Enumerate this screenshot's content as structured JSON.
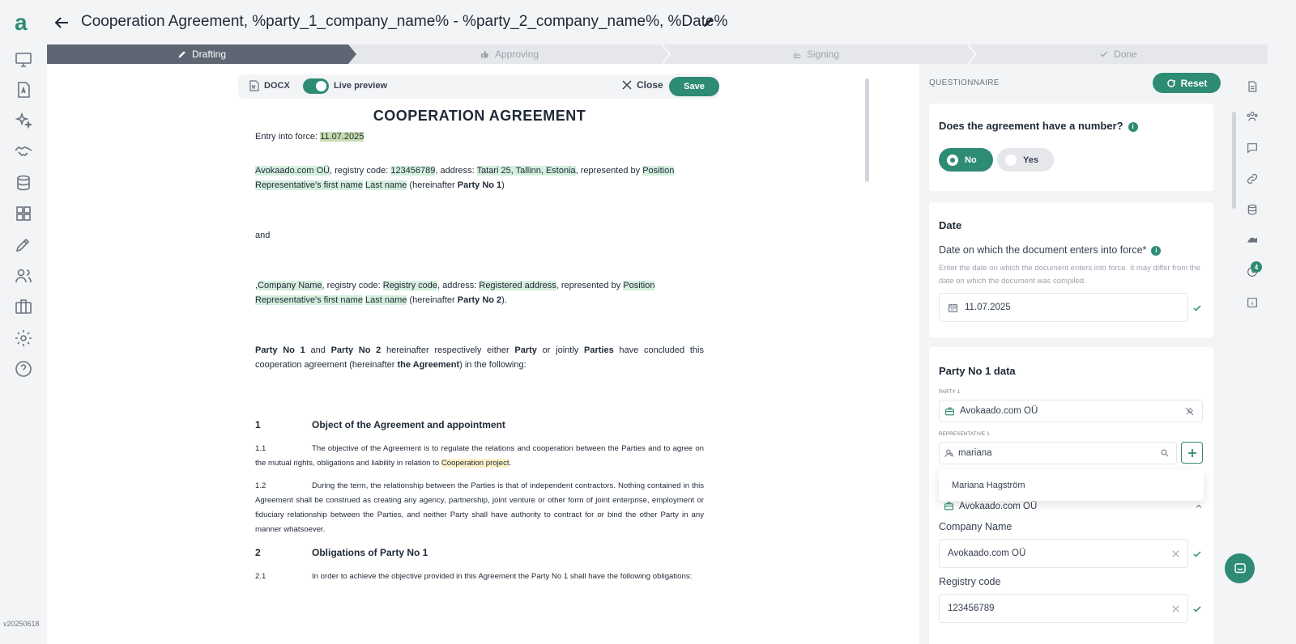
{
  "app": {
    "version": "v20250618"
  },
  "header": {
    "title": "Cooperation Agreement, %party_1_company_name% - %party_2_company_name%, %Date%"
  },
  "stepper": {
    "steps": [
      {
        "label": "Drafting",
        "state": "active"
      },
      {
        "label": "Approving",
        "state": "pending"
      },
      {
        "label": "Signing",
        "state": "pending"
      },
      {
        "label": "Done",
        "state": "pending"
      }
    ]
  },
  "toolbar": {
    "docx_label": "DOCX",
    "live_preview_label": "Live preview",
    "live_preview_on": true,
    "close_label": "Close",
    "save_label": "Save"
  },
  "document": {
    "title": "COOPERATION AGREEMENT",
    "entry_prefix": "Entry into force: ",
    "entry_date": "11.07.2025",
    "party1": {
      "company": "Avokaado.com OÜ",
      "reg_prefix": ", registry code: ",
      "reg_code": "123456789",
      "addr_prefix": ", address: ",
      "address": "Tatari 25, Tallinn, Estonia",
      "rep_prefix": ", represented by ",
      "position": "Position",
      "first_name": "Representative's first name",
      "last_name": "Last name",
      "hereinafter": " (hereinafter ",
      "party_label": "Party No 1",
      "close": ")"
    },
    "and": "and",
    "party2": {
      "lead": ",",
      "company": "Company Name",
      "reg_prefix": ", registry code: ",
      "reg_code": "Registry code",
      "addr_prefix": ", address: ",
      "address": "Registered address",
      "rep_prefix": ", represented by ",
      "position": "Position",
      "first_name": "Representative's first name",
      "last_name": "Last name",
      "hereinafter": " (hereinafter ",
      "party_label": "Party No 2",
      "close": ")."
    },
    "intro": {
      "p1": "Party No 1",
      "and": " and ",
      "p2": "Party No 2",
      "t1": " hereinafter respectively either ",
      "party": "Party",
      "t2": " or jointly ",
      "parties": "Parties",
      "t3": " have concluded this cooperation agreement (hereinafter ",
      "agreement": "the Agreement",
      "t4": ") in the following:"
    },
    "sections": [
      {
        "num": "1",
        "title": "Object of the Agreement and appointment"
      },
      {
        "num": "2",
        "title": "Obligations of Party No 1"
      }
    ],
    "clauses": {
      "c11_num": "1.1",
      "c11_text": "The objective of the Agreement is to regulate the relations and cooperation between the Parties and to agree on the mutual rights, obligations and liability in relation to ",
      "c11_hl": "Cooperation project",
      "c11_end": ".",
      "c12_num": "1.2",
      "c12_text": "During the term, the relationship between the Parties is that of independent contractors. Nothing contained in this Agreement shall be construed as creating any agency, partnership, joint venture or other form of joint enterprise, employment or fiduciary relationship between the Parties, and neither Party shall have authority to contract for or bind the other Party in any manner whatsoever.",
      "c21_num": "2.1",
      "c21_text": "In order to achieve the objective provided in this Agreement the Party No 1 shall have the following obligations:"
    }
  },
  "questionnaire": {
    "label": "QUESTIONNAIRE",
    "reset_label": "Reset",
    "q_number": {
      "question": "Does the agreement have a number?",
      "options": [
        "No",
        "Yes"
      ],
      "selected": "No"
    },
    "date_card": {
      "title": "Date",
      "question": "Date on which the document enters into force*",
      "hint": "Enter the date on which the document enters into force. It may differ from the date on which the document was compiled.",
      "value": "11.07.2025"
    },
    "party1_card": {
      "title": "Party No 1 data",
      "party_caption": "PARTY 1",
      "party_value": "Avokaado.com OÜ",
      "rep_caption": "REPRESENTATIVE 1",
      "rep_search": "mariana",
      "suggestion": "Mariana Hagström",
      "collapsed_company": "Avokaado.com OÜ",
      "company_label": "Company Name",
      "company_value": "Avokaado.com OÜ",
      "reg_label": "Registry code",
      "reg_value": "123456789"
    }
  },
  "right_rail": {
    "badge": "4"
  },
  "colors": {
    "accent": "#2e8b74",
    "highlight": "#d5eedd",
    "highlight_yellow": "#fdf1c7",
    "stepper_active": "#5f6673"
  }
}
